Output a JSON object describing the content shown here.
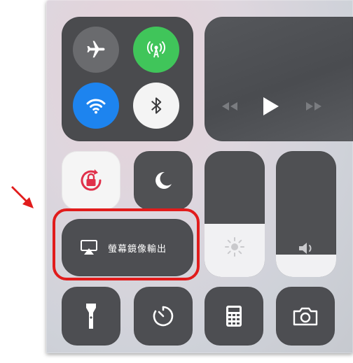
{
  "control_center": {
    "screen_mirroring_label": "螢幕鏡像輸出",
    "media": {
      "prev_icon": "rewind-icon",
      "play_icon": "play-icon",
      "next_icon": "fast-forward-icon"
    },
    "brightness_level": 0.42,
    "volume_level": 0.18,
    "colors": {
      "cellular": "#40c55a",
      "wifi": "#1d84ef",
      "rotation_lock": "#e0304a",
      "highlight": "#e11c1c"
    },
    "icons": [
      "airplane-icon",
      "cellular-icon",
      "wifi-icon",
      "bluetooth-icon",
      "rotation-lock-icon",
      "moon-icon",
      "sun-icon",
      "speaker-icon",
      "airplay-icon",
      "flashlight-icon",
      "timer-icon",
      "calculator-icon",
      "camera-icon"
    ]
  }
}
